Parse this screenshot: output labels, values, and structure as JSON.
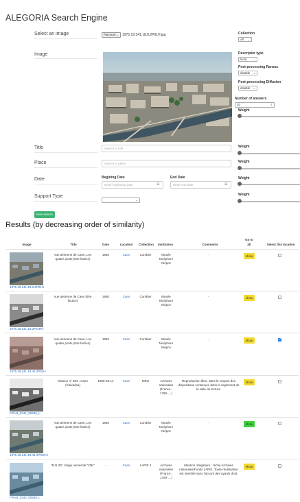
{
  "app_title": "ALEGORIA Search Engine",
  "form": {
    "select_image_label": "Select an image",
    "file_button_label": "Parcourir…",
    "file_name": "1975.19.141.18.8.2P01H.jpg",
    "image_label": "Image",
    "title_label": "Title",
    "title_placeholder": "Search in title",
    "place_label": "Place",
    "place_placeholder": "Search in place",
    "date_label": "Date",
    "begin_date_label": "Begining Date",
    "begin_date_placeholder": "Enter beginning date",
    "end_date_label": "End Date",
    "end_date_placeholder": "Enter end date",
    "support_type_label": "Support Type",
    "new_search_label": "New search"
  },
  "right_panel": {
    "collection_label": "Collection",
    "collection_value": "All",
    "descriptor_label": "Descriptor type",
    "descriptor_value": "local",
    "ransac_label": "Post-processing Ransac",
    "ransac_value": "disable",
    "diffusion_label": "Post-processing Diffusion",
    "diffusion_value": "disable",
    "answers_label": "Number of answers",
    "answers_value": "20",
    "weight_label": "Weight"
  },
  "results": {
    "title": "Results (by decreasing order of similarity)",
    "headers": {
      "image": "Image",
      "title": "Title",
      "date": "Date",
      "location": "Location",
      "collection": "Collection",
      "institution": "Institution",
      "comments": "Comments",
      "goto": "Go to 3D",
      "select": "Select this location"
    },
    "show_label": "show",
    "rows": [
      {
        "caption": "1975.19.141.18.8.2P01H",
        "title": "Vue aérienne de Caen, Les quatre ponts (titre factice)",
        "date": "1950",
        "location": "Caen",
        "collection": "Combier",
        "institution": "Musée Nicéphore Niépce",
        "comments": "-",
        "show_color": "#f2d82e",
        "checked": false
      },
      {
        "caption": "1975.19.141.18.3P01RH",
        "title": "Vue aérienne de Caen (titre factice)",
        "date": "1950",
        "location": "Caen",
        "collection": "Combier",
        "institution": "Musée Nicéphore Niépce",
        "comments": "-",
        "show_color": "#f2d82e",
        "checked": false
      },
      {
        "caption": "1975.19.141.18.44.2P01H",
        "title": "Vue aérienne de Caen, Les quatre ponts (titre factice)",
        "date": "1950",
        "location": "Caen",
        "collection": "Combier",
        "institution": "Musée Nicéphore Niépce",
        "comments": "-",
        "show_color": "#f2d82e",
        "checked": true
      },
      {
        "caption": "FRAN_0241_08496_L",
        "title": "Mission n° 684 : Caen (Calvados)",
        "date": "1956-03-14",
        "location": "Caen",
        "collection": "MRU",
        "institution": "Archives nationales (France ; 1790-....)",
        "comments": "Reproduction libre, dans le respect des dispositions contenues dans le règlement de la salle de lecture.",
        "show_color": "#f2d82e",
        "checked": false
      },
      {
        "caption": "1975.19.141.18.44.1P01RH",
        "title": "Vue aérienne de Caen, Les quatre ponts (titre factice)",
        "date": "1950",
        "location": "Caen",
        "collection": "Combier",
        "institution": "Musée Nicéphore Niépce",
        "comments": "-",
        "show_color": "#3cd13c",
        "checked": false
      },
      {
        "caption": "FRAN_0242_00909_L",
        "title": "\"B.N.30\", tirage numéroté \"20K\"",
        "date": "-",
        "location": "Caen",
        "collection": "LAPIE 2",
        "institution": "Archives nationales (France ; 1790-....)",
        "comments": "Mention obligatoire : cliché Archives nationales/Fonds LAPIE. Toute réutilisation est interdite sans l'accord des ayants droit.",
        "show_color": "#f2d82e",
        "checked": false
      }
    ]
  }
}
